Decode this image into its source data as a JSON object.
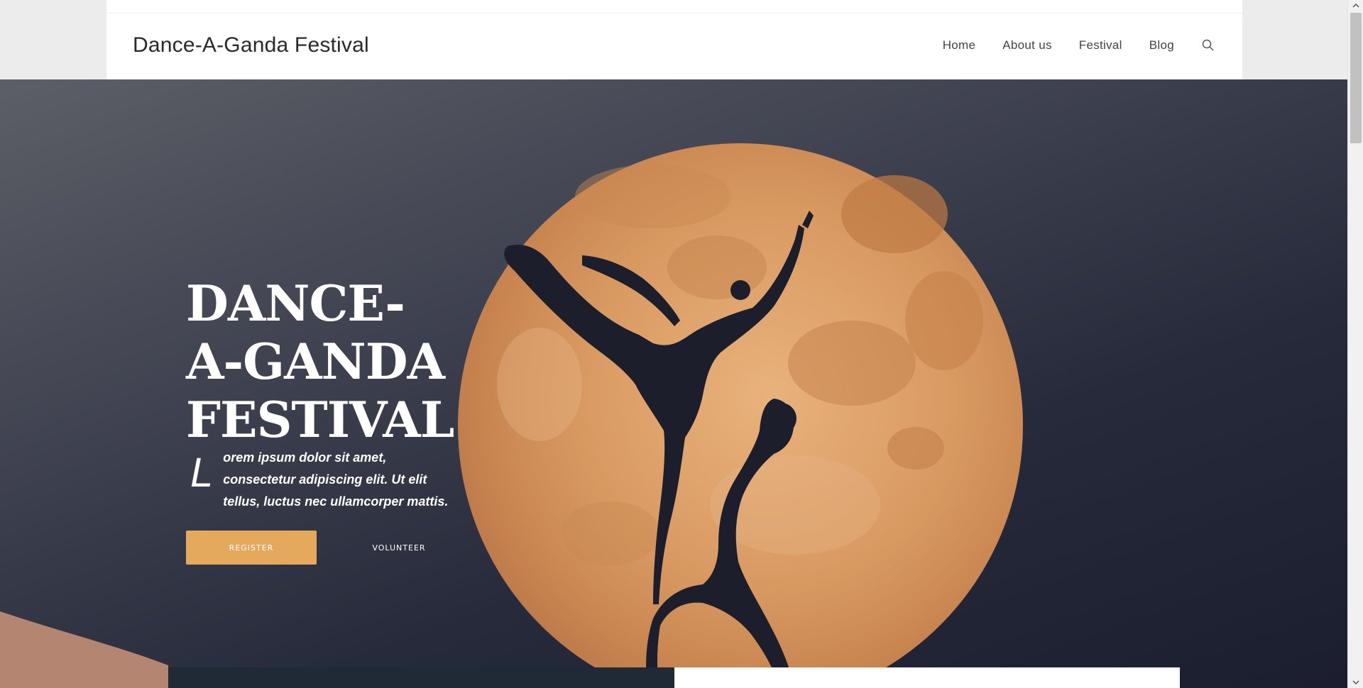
{
  "header": {
    "site_title": "Dance-A-Ganda Festival",
    "nav": [
      "Home",
      "About us",
      "Festival",
      "Blog"
    ],
    "search_icon": "search-icon"
  },
  "hero": {
    "heading_lines": [
      "DANCE-",
      "A-GANDA",
      "FESTIVAL"
    ],
    "dropcap": "L",
    "text": "orem ipsum dolor sit amet, consectetur adipiscing elit. Ut elit tellus, luctus nec ullamcorper mattis.",
    "register_label": "Register",
    "volunteer_label": "Volunteer"
  },
  "colors": {
    "accent": "#e4a95d",
    "moon": "#d99a62",
    "hero_dark": "#1b1e2e",
    "hill": "#b48672"
  }
}
